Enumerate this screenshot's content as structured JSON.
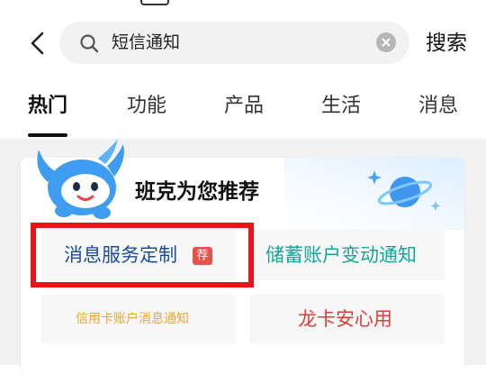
{
  "header": {
    "search_query": "短信通知",
    "search_button": "搜索",
    "icons": [
      "back-arrow-icon",
      "search-icon",
      "clear-icon"
    ]
  },
  "tabs": [
    {
      "label": "热门",
      "active": true
    },
    {
      "label": "功能",
      "active": false
    },
    {
      "label": "产品",
      "active": false
    },
    {
      "label": "生活",
      "active": false
    },
    {
      "label": "消息",
      "active": false
    }
  ],
  "recommend": {
    "title": "班克为您推荐",
    "items": [
      {
        "label": "消息服务定制",
        "tag": "荐",
        "color": "#1a4d9e"
      },
      {
        "label": "储蓄账户变动通知",
        "color": "#13a79a"
      },
      {
        "label": "信用卡账户消息通知",
        "color": "#f0a431"
      },
      {
        "label": "龙卡安心用",
        "color": "#e23b3b"
      }
    ]
  },
  "colors": {
    "highlight_border": "#e81416",
    "page_background": "#f2f2f2",
    "tag_background": "#e5534b"
  }
}
